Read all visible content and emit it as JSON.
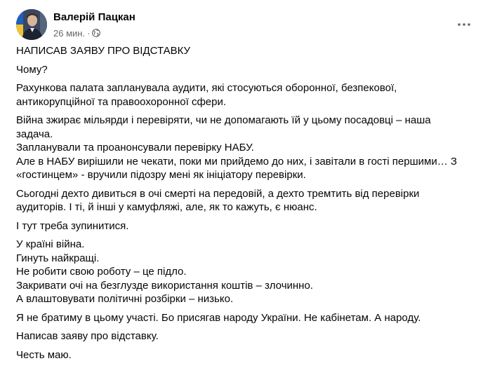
{
  "post": {
    "author": "Валерій Пацкан",
    "time": "26 мин.",
    "dot": "·",
    "privacy_icon": "globe-icon",
    "more_icon": "more-options-icon",
    "paragraphs": [
      [
        "НАПИСАВ ЗАЯВУ ПРО ВІДСТАВКУ"
      ],
      [
        "Чому?"
      ],
      [
        "Рахункова палата запланувала аудити, які стосуються оборонної, безпекової,",
        "антикорупційної та правоохоронної сфери."
      ],
      [
        "Війна зжирає мільярди і перевіряти, чи не допомагають їй у цьому посадовці – наша",
        "задача.",
        "Запланували та проанонсували перевірку НАБУ.",
        "Але в НАБУ вирішили не чекати, поки ми прийдемо до них, і завітали в гості першими… З",
        "«гостинцем» - вручили підозру мені як ініціатору перевірки."
      ],
      [
        "Сьогодні дехто дивиться в очі смерті на передовій, а дехто тремтить від перевірки",
        "аудиторів. І ті, й інші у камуфляжі, але, як то кажуть, є нюанс."
      ],
      [
        "І тут треба зупинитися."
      ],
      [
        "У країні війна.",
        "Гинуть найкращі.",
        "Не робити свою роботу – це підло.",
        "Закривати очі на безглузде використання коштів  – злочинно.",
        "А влаштовувати політичні розбірки – низько."
      ],
      [
        "Я не братиму в цьому участі. Бо присягав народу України. Не кабінетам. А народу."
      ],
      [
        "Написав заяву про відставку."
      ],
      [
        "Честь маю."
      ]
    ]
  },
  "colors": {
    "text": "#050505",
    "secondary": "#65676b",
    "background": "#ffffff"
  }
}
